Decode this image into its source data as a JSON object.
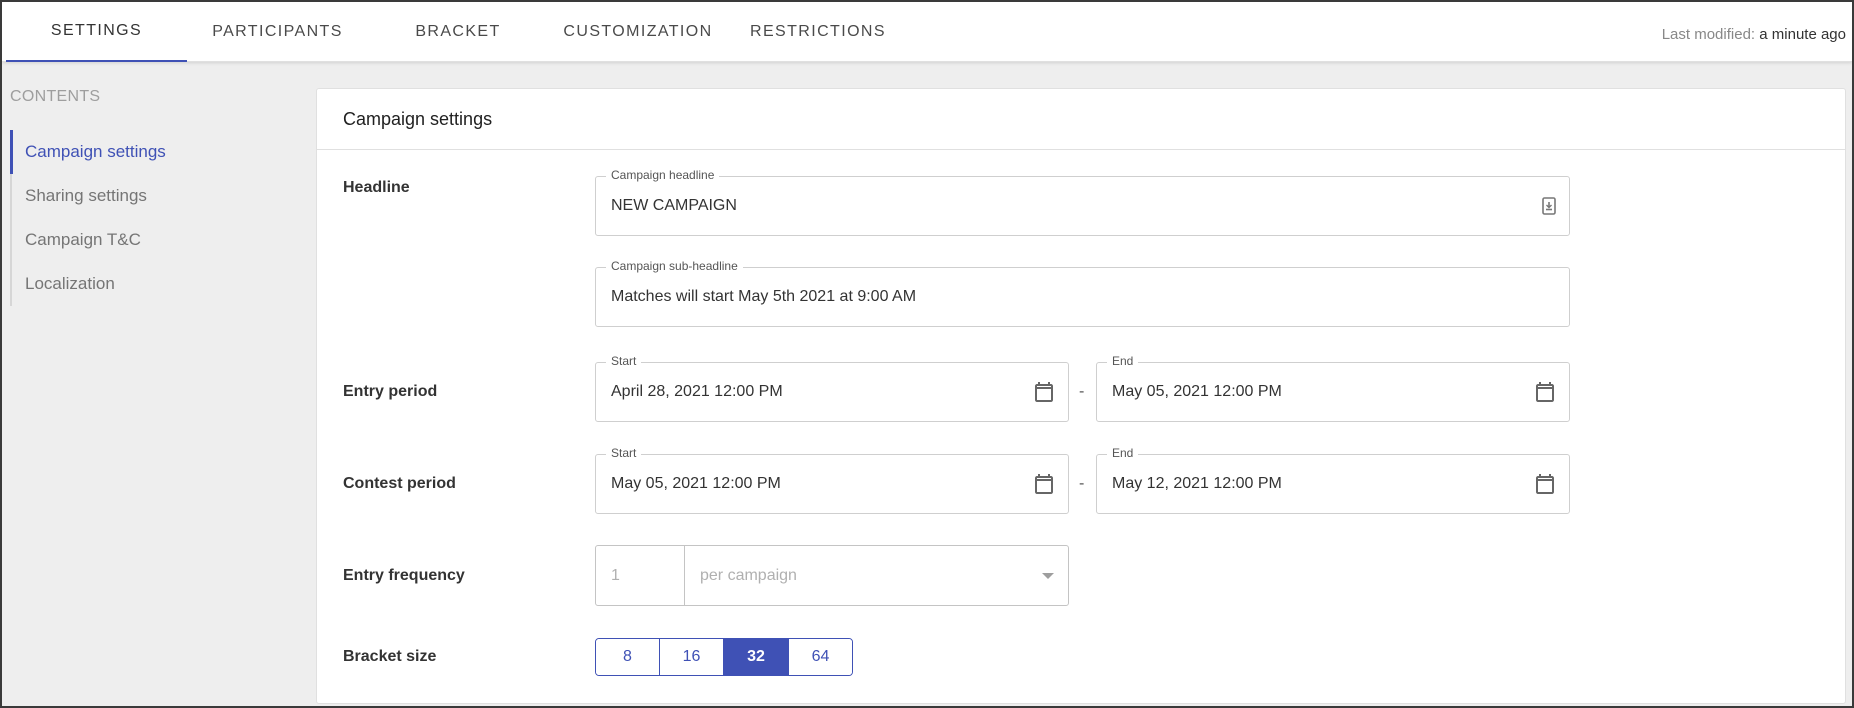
{
  "tabs": [
    {
      "label": "SETTINGS",
      "active": true
    },
    {
      "label": "PARTICIPANTS",
      "active": false
    },
    {
      "label": "BRACKET",
      "active": false
    },
    {
      "label": "CUSTOMIZATION",
      "active": false
    },
    {
      "label": "RESTRICTIONS",
      "active": false
    }
  ],
  "last_modified": {
    "label": "Last modified:",
    "value": "a minute ago"
  },
  "sidebar": {
    "heading": "CONTENTS",
    "items": [
      {
        "label": "Campaign settings",
        "active": true
      },
      {
        "label": "Sharing settings",
        "active": false
      },
      {
        "label": "Campaign T&C",
        "active": false
      },
      {
        "label": "Localization",
        "active": false
      }
    ]
  },
  "card": {
    "title": "Campaign settings",
    "headline": {
      "label": "Headline",
      "campaign_headline": {
        "legend": "Campaign headline",
        "value": "NEW CAMPAIGN",
        "icon": "text-snippet-icon"
      },
      "campaign_subheadline": {
        "legend": "Campaign sub-headline",
        "value": "Matches will start May 5th 2021 at 9:00 AM"
      }
    },
    "entry_period": {
      "label": "Entry period",
      "separator": "-",
      "start": {
        "legend": "Start",
        "value": "April 28, 2021 12:00 PM"
      },
      "end": {
        "legend": "End",
        "value": "May 05, 2021 12:00 PM"
      }
    },
    "contest_period": {
      "label": "Contest period",
      "separator": "-",
      "start": {
        "legend": "Start",
        "value": "May 05, 2021 12:00 PM"
      },
      "end": {
        "legend": "End",
        "value": "May 12, 2021 12:00 PM"
      }
    },
    "entry_frequency": {
      "label": "Entry frequency",
      "count_placeholder": "1",
      "period_placeholder": "per campaign"
    },
    "bracket_size": {
      "label": "Bracket size",
      "options": [
        "8",
        "16",
        "32",
        "64"
      ],
      "selected": "32"
    }
  },
  "colors": {
    "accent": "#3f51b5",
    "background": "#eeeeee",
    "card": "#ffffff"
  }
}
